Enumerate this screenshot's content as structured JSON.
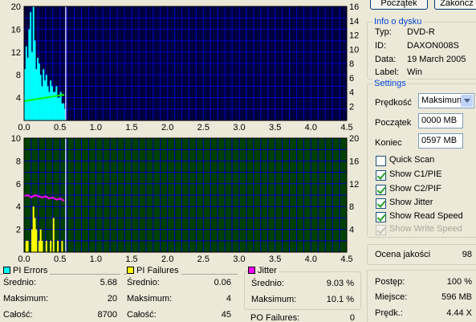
{
  "buttons": {
    "start": "Początek",
    "stop": "Zakończ"
  },
  "disc_info": {
    "title": "Info o dysku",
    "rows": [
      {
        "label": "Typ:",
        "value": "DVD-R"
      },
      {
        "label": "ID:",
        "value": "DAXON008S"
      },
      {
        "label": "Data:",
        "value": "19 March 2005"
      },
      {
        "label": "Label:",
        "value": "Win"
      }
    ]
  },
  "settings": {
    "title": "Settings",
    "speed_label": "Prędkość",
    "speed_value": "Maksimun",
    "start_label": "Początek",
    "start_value": "0000 MB",
    "end_label": "Koniec",
    "end_value": "0597 MB",
    "options": [
      {
        "label": "Quick Scan",
        "checked": false,
        "enabled": true
      },
      {
        "label": "Show C1/PIE",
        "checked": true,
        "enabled": true
      },
      {
        "label": "Show C2/PIF",
        "checked": true,
        "enabled": true
      },
      {
        "label": "Show Jitter",
        "checked": true,
        "enabled": true
      },
      {
        "label": "Show Read Speed",
        "checked": true,
        "enabled": true
      },
      {
        "label": "Show Write Speed",
        "checked": true,
        "enabled": false
      }
    ]
  },
  "quality": {
    "label": "Ocena jakości",
    "value": "98"
  },
  "progress": {
    "rows": [
      {
        "label": "Postęp:",
        "value": "100 %"
      },
      {
        "label": "Miejsce:",
        "value": "596 MB"
      },
      {
        "label": "Prędk.:",
        "value": "4.44 X"
      }
    ]
  },
  "stats": {
    "pi_errors": {
      "title": "PI Errors",
      "color": "#00ffff",
      "rows": [
        {
          "label": "Średnio:",
          "value": "5.68"
        },
        {
          "label": "Maksimum:",
          "value": "20"
        },
        {
          "label": "Całość:",
          "value": "8700"
        }
      ]
    },
    "pi_failures": {
      "title": "PI Failures",
      "color": "#ffff00",
      "rows": [
        {
          "label": "Średnio:",
          "value": "0.06"
        },
        {
          "label": "Maksimum:",
          "value": "4"
        },
        {
          "label": "Całość:",
          "value": "45"
        }
      ]
    },
    "jitter": {
      "title": "Jitter",
      "color": "#ff00ff",
      "rows": [
        {
          "label": "Średnio:",
          "value": "9.03 %"
        },
        {
          "label": "Maksimum:",
          "value": "10.1 %"
        }
      ]
    },
    "po_failures": {
      "label": "PO Failures:",
      "value": "0"
    }
  },
  "chart_data": [
    {
      "type": "bar",
      "background": "#000040",
      "grid_color": "#0000c0",
      "xlim": [
        0,
        4.5
      ],
      "ylim_left": [
        0,
        20
      ],
      "ylim_right": [
        0,
        16
      ],
      "x_ticks": [
        "0.0",
        "0.5",
        "1.0",
        "1.5",
        "2.0",
        "2.5",
        "3.0",
        "3.5",
        "4.0",
        "4.5"
      ],
      "y_ticks_left": [
        "4",
        "8",
        "12",
        "16",
        "20"
      ],
      "y_ticks_right": [
        "2",
        "4",
        "6",
        "8",
        "10",
        "12",
        "14",
        "16"
      ],
      "position_marker_x": 0.58,
      "series": [
        {
          "kind": "bars",
          "color": "#00ffff",
          "x": [
            0.0,
            0.02,
            0.04,
            0.06,
            0.08,
            0.1,
            0.12,
            0.14,
            0.16,
            0.18,
            0.2,
            0.22,
            0.24,
            0.26,
            0.28,
            0.3,
            0.32,
            0.34,
            0.36,
            0.38,
            0.4,
            0.42,
            0.44,
            0.46,
            0.48,
            0.5,
            0.52,
            0.54,
            0.56
          ],
          "values": [
            9,
            13,
            11,
            16,
            19,
            12,
            20,
            14,
            9,
            11,
            10,
            8,
            6,
            9,
            7,
            8,
            6,
            5,
            7,
            6,
            5,
            5,
            6,
            4,
            4,
            5,
            3,
            3,
            2
          ]
        },
        {
          "kind": "line",
          "color": "#00ff00",
          "x": [
            0.0,
            0.1,
            0.2,
            0.3,
            0.4,
            0.5,
            0.56
          ],
          "values": [
            3.4,
            3.6,
            3.8,
            4.0,
            4.2,
            4.4,
            4.5
          ]
        }
      ]
    },
    {
      "type": "bar",
      "background": "#004000",
      "grid_color": "#0000c0",
      "xlim": [
        0,
        4.5
      ],
      "ylim_left": [
        0,
        10
      ],
      "ylim_right": [
        0,
        20
      ],
      "x_ticks": [
        "0.0",
        "0.5",
        "1.0",
        "1.5",
        "2.0",
        "2.5",
        "3.0",
        "3.5",
        "4.0",
        "4.5"
      ],
      "y_ticks_left": [
        "2",
        "4",
        "6",
        "8",
        "10"
      ],
      "y_ticks_right": [
        "4",
        "8",
        "12",
        "16",
        "20"
      ],
      "position_marker_x": 0.58,
      "series": [
        {
          "kind": "bars",
          "color": "#ffff00",
          "x": [
            0.02,
            0.04,
            0.1,
            0.12,
            0.14,
            0.16,
            0.2,
            0.22,
            0.24,
            0.3,
            0.36,
            0.4,
            0.46,
            0.52
          ],
          "values": [
            1,
            1,
            2,
            4,
            3,
            2,
            1,
            2,
            1,
            1,
            1,
            3,
            1,
            1
          ]
        },
        {
          "kind": "line",
          "color": "#ff00ff",
          "x": [
            0.0,
            0.05,
            0.1,
            0.15,
            0.2,
            0.25,
            0.3,
            0.35,
            0.4,
            0.45,
            0.5,
            0.56
          ],
          "values": [
            4.9,
            5.0,
            4.8,
            5.0,
            4.9,
            4.8,
            4.9,
            4.7,
            4.8,
            4.6,
            4.7,
            4.5
          ]
        }
      ]
    }
  ]
}
